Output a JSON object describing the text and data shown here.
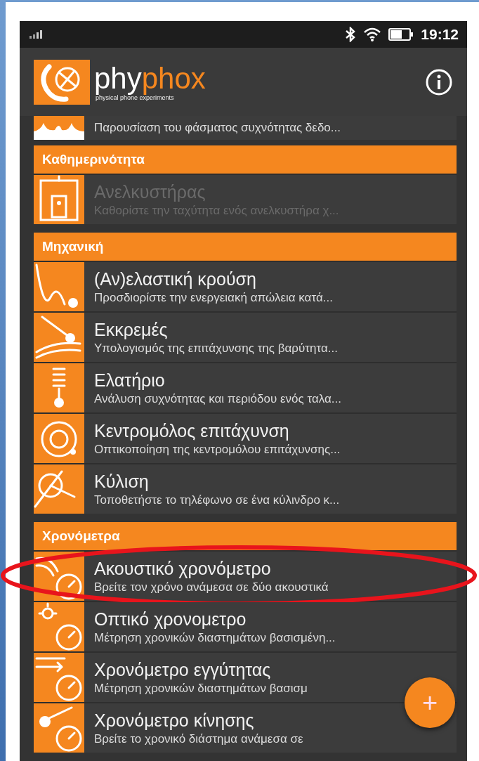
{
  "status_bar": {
    "time": "19:12"
  },
  "app_bar": {
    "logo_prefix": "phy",
    "logo_suffix": "phox",
    "tagline": "physical phone experiments"
  },
  "partial_item": {
    "subtitle": "Παρουσίαση του φάσματος συχνότητας δεδο..."
  },
  "sections": [
    {
      "title": "Καθημερινότητα",
      "items": [
        {
          "title": "Ανελκυστήρας",
          "subtitle": "Καθορίστε την ταχύτητα ενός ανελκυστήρα χ...",
          "disabled": true,
          "highlighted": false
        }
      ]
    },
    {
      "title": "Μηχανική",
      "items": [
        {
          "title": "(Αν)ελαστική κρούση",
          "subtitle": "Προσδιορίστε την ενεργειακή απώλεια κατά...",
          "disabled": false,
          "highlighted": false
        },
        {
          "title": "Εκκρεμές",
          "subtitle": "Υπολογισμός της επιτάχυνσης της βαρύτητα...",
          "disabled": false,
          "highlighted": false
        },
        {
          "title": "Ελατήριο",
          "subtitle": "Ανάλυση συχνότητας και περιόδου ενός ταλα...",
          "disabled": false,
          "highlighted": false
        },
        {
          "title": "Κεντρομόλος επιτάχυνση",
          "subtitle": "Οπτικοποίηση της κεντρομόλου επιτάχυνσης...",
          "disabled": false,
          "highlighted": false
        },
        {
          "title": "Κύλιση",
          "subtitle": "Τοποθετήστε το τηλέφωνο σε ένα κύλινδρο κ...",
          "disabled": false,
          "highlighted": false
        }
      ]
    },
    {
      "title": "Χρονόμετρα",
      "items": [
        {
          "title": "Ακουστικό χρονόμετρο",
          "subtitle": "Βρείτε τον χρόνο ανάμεσα σε δύο ακουστικά",
          "disabled": false,
          "highlighted": true
        },
        {
          "title": "Οπτικό χρονομετρο",
          "subtitle": "Μέτρηση χρονικών διαστημάτων βασισμένη...",
          "disabled": false,
          "highlighted": false
        },
        {
          "title": "Χρονόμετρο εγγύτητας",
          "subtitle": "Μέτρηση χρονικών διαστημάτων βασισμ",
          "disabled": false,
          "highlighted": false
        },
        {
          "title": "Χρονόμετρο κίνησης",
          "subtitle": "Βρείτε το χρονικό διάστημα ανάμεσα σε",
          "disabled": false,
          "highlighted": false
        }
      ]
    }
  ],
  "fab": {
    "label": "+"
  }
}
